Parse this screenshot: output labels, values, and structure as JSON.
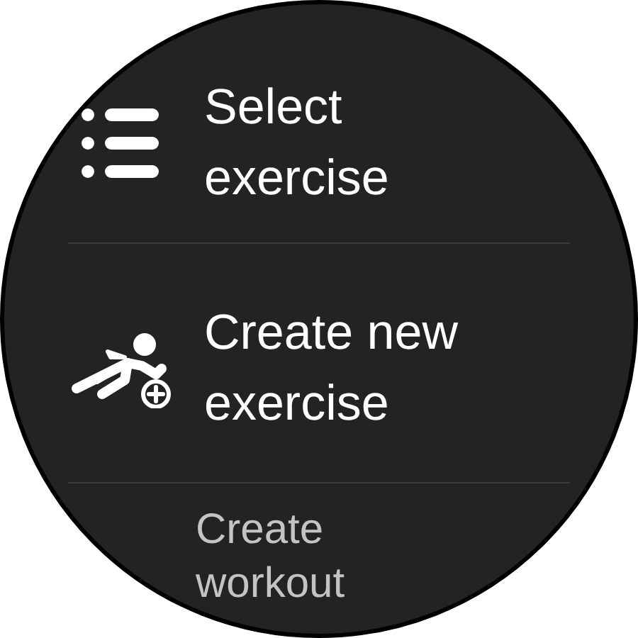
{
  "menu": [
    {
      "label": "Select exercise",
      "kind": "list",
      "dimmed": false
    },
    {
      "label": "Create new exercise",
      "kind": "runner-add",
      "dimmed": false
    },
    {
      "label": "Create workout",
      "kind": "none",
      "dimmed": true
    }
  ]
}
